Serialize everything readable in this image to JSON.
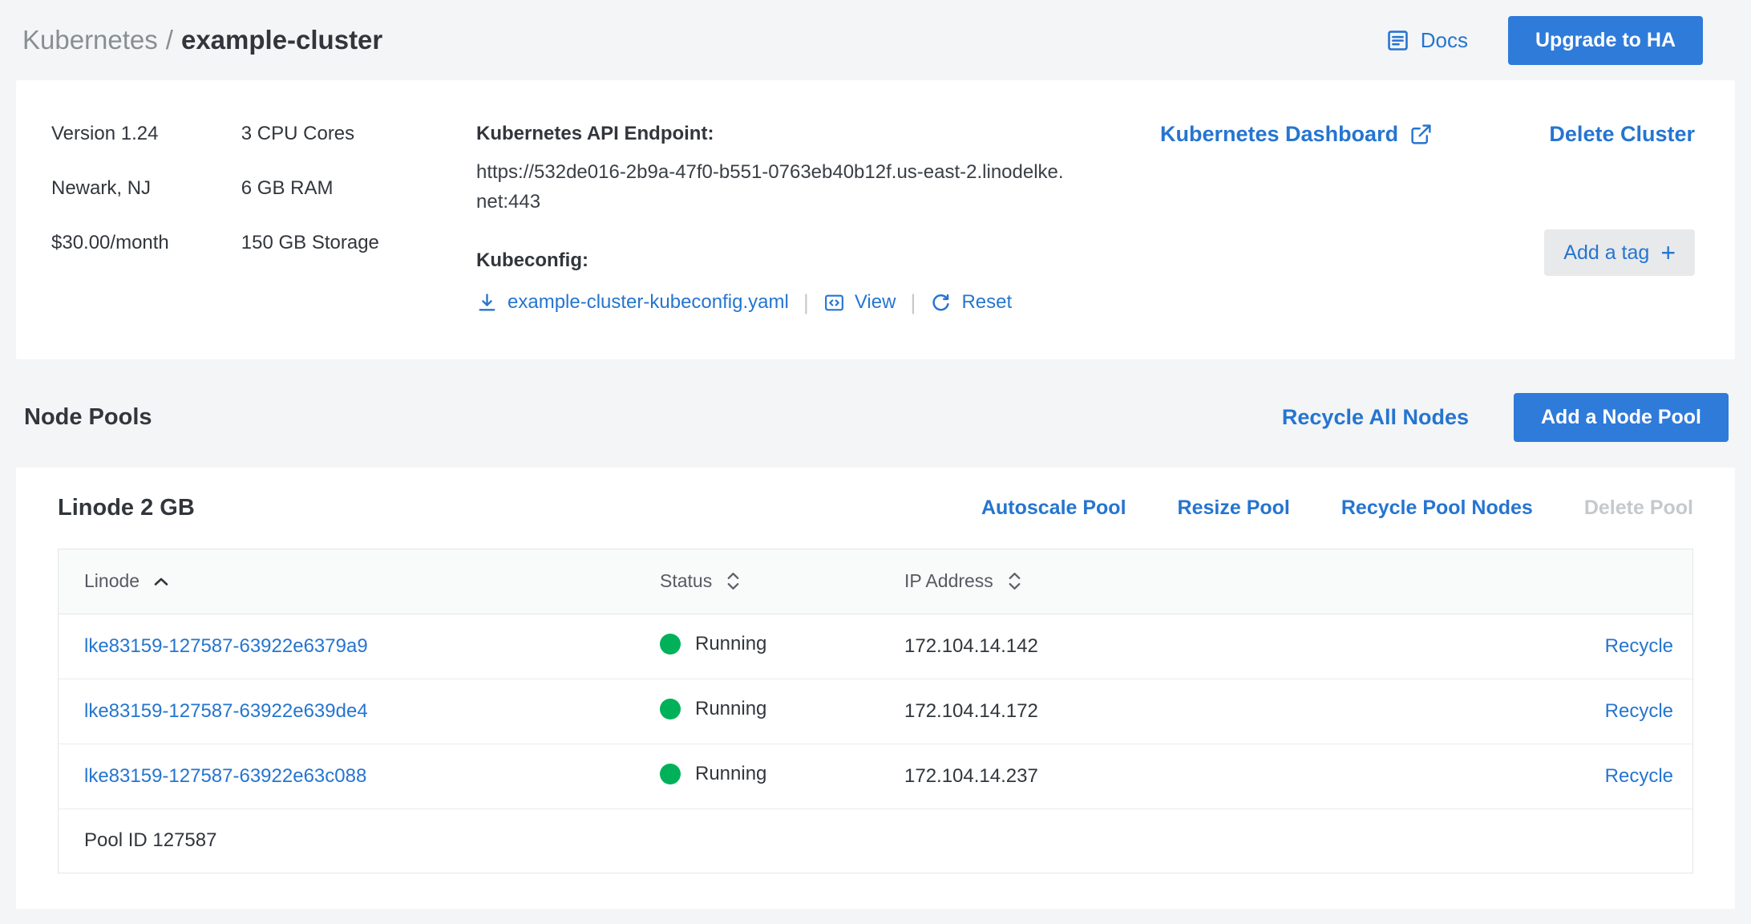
{
  "colors": {
    "accent": "#2575d0",
    "button_blue": "#2f7bd9",
    "running_green": "#00b159",
    "page_background": "#f4f5f6"
  },
  "breadcrumb": {
    "section": "Kubernetes",
    "separator": "/",
    "current": "example-cluster"
  },
  "topbar": {
    "docs_label": "Docs",
    "upgrade_button_label": "Upgrade to HA"
  },
  "summary": {
    "specs_left": [
      "Version 1.24",
      "Newark, NJ",
      "$30.00/month"
    ],
    "specs_right": [
      "3 CPU Cores",
      "6 GB RAM",
      "150 GB Storage"
    ],
    "api_endpoint_label": "Kubernetes API Endpoint:",
    "api_endpoint_url": "https://532de016-2b9a-47f0-b551-0763eb40b12f.us-east-2.linodelke.net:443",
    "kubeconfig_label": "Kubeconfig:",
    "kubeconfig_filename": "example-cluster-kubeconfig.yaml",
    "view_label": "View",
    "reset_label": "Reset",
    "separator": "|",
    "dashboard_link_label": "Kubernetes Dashboard",
    "delete_cluster_label": "Delete Cluster",
    "add_tag_label": "Add a tag",
    "add_tag_plus": "+"
  },
  "node_pools": {
    "section_title": "Node Pools",
    "recycle_all_label": "Recycle All Nodes",
    "add_pool_button_label": "Add a Node Pool"
  },
  "pool": {
    "name": "Linode 2 GB",
    "actions": [
      {
        "label": "Autoscale Pool",
        "enabled": true
      },
      {
        "label": "Resize Pool",
        "enabled": true
      },
      {
        "label": "Recycle Pool Nodes",
        "enabled": true
      },
      {
        "label": "Delete Pool",
        "enabled": false
      }
    ],
    "table": {
      "columns": [
        {
          "label": "Linode",
          "sort": "asc"
        },
        {
          "label": "Status",
          "sort": "none"
        },
        {
          "label": "IP Address",
          "sort": "none"
        }
      ],
      "rows": [
        {
          "linode": "lke83159-127587-63922e6379a9",
          "status": "Running",
          "ip": "172.104.14.142",
          "action_label": "Recycle"
        },
        {
          "linode": "lke83159-127587-63922e639de4",
          "status": "Running",
          "ip": "172.104.14.172",
          "action_label": "Recycle"
        },
        {
          "linode": "lke83159-127587-63922e63c088",
          "status": "Running",
          "ip": "172.104.14.237",
          "action_label": "Recycle"
        }
      ],
      "footer_text": "Pool ID 127587"
    }
  }
}
